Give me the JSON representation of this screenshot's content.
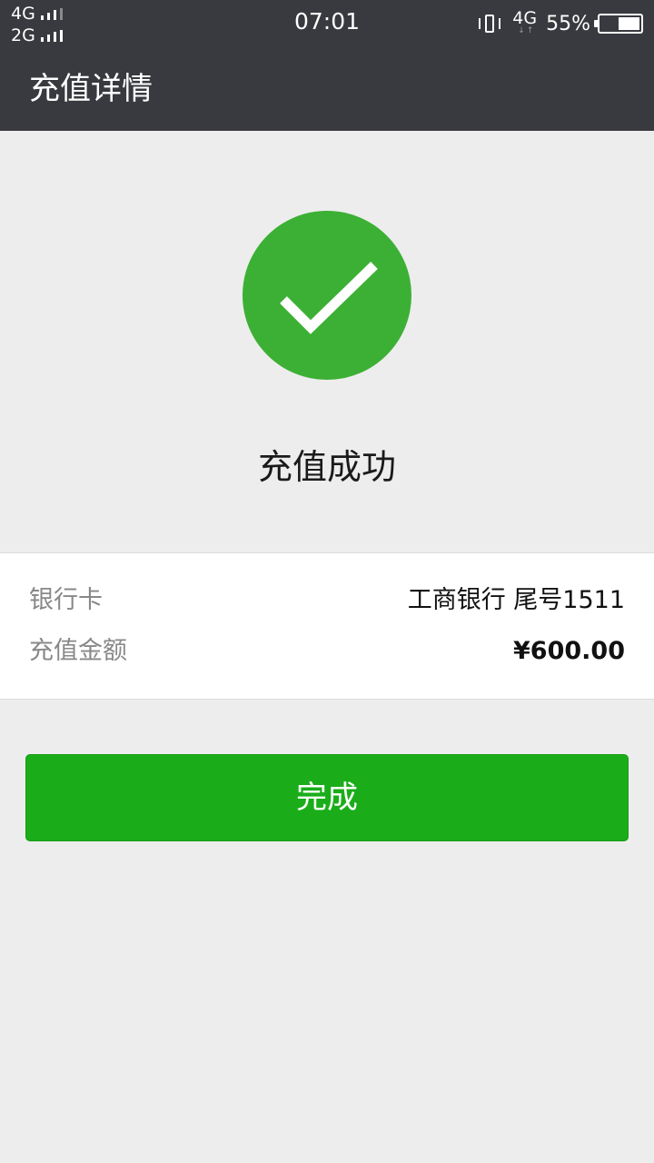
{
  "status_bar": {
    "sim1_network": "4G",
    "sim2_network": "2G",
    "time": "07:01",
    "data_network": "4G",
    "battery_percent": "55%",
    "battery_level": 0.55,
    "icons": [
      "signal-icon",
      "vibrate-icon",
      "battery-icon"
    ]
  },
  "header": {
    "title": "充值详情"
  },
  "result": {
    "icon": "check-circle-icon",
    "icon_color": "#3cb034",
    "message": "充值成功"
  },
  "details": {
    "bank_card_label": "银行卡",
    "bank_card_value": "工商银行 尾号1511",
    "amount_label": "充值金额",
    "amount_value": "¥600.00"
  },
  "actions": {
    "done_label": "完成",
    "done_color": "#1aad19"
  }
}
